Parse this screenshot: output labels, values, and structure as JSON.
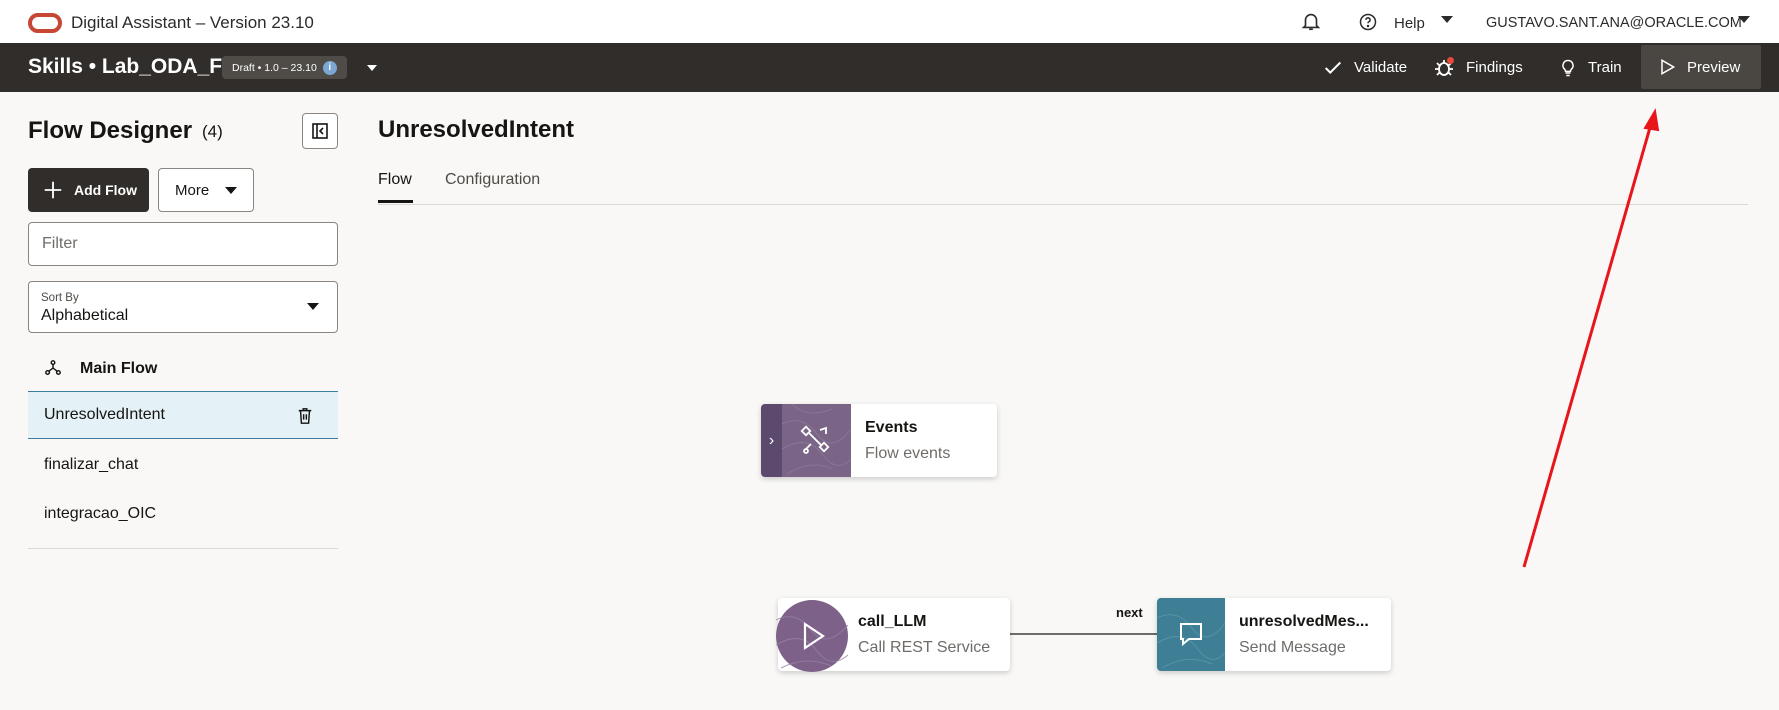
{
  "header": {
    "app_title": "Digital Assistant – Version 23.10",
    "help_label": "Help",
    "user_label": "GUSTAVO.SANT.ANA@ORACLE.COM"
  },
  "toolbar": {
    "skill_title": "Skills • Lab_ODA_FT",
    "version_badge": "Draft • 1.0 – 23.10",
    "info_glyph": "i",
    "validate_label": "Validate",
    "findings_label": "Findings",
    "train_label": "Train",
    "preview_label": "Preview"
  },
  "sidebar": {
    "title": "Flow Designer",
    "count": "(4)",
    "add_flow_label": "Add Flow",
    "more_label": "More",
    "filter_placeholder": "Filter",
    "sort_label": "Sort By",
    "sort_value": "Alphabetical",
    "main_flow_label": "Main Flow",
    "flows": [
      {
        "label": "UnresolvedIntent",
        "selected": true
      },
      {
        "label": "finalizar_chat",
        "selected": false
      },
      {
        "label": "integracao_OIC",
        "selected": false
      }
    ]
  },
  "main": {
    "title": "UnresolvedIntent",
    "tabs": [
      {
        "label": "Flow",
        "active": true
      },
      {
        "label": "Configuration",
        "active": false
      }
    ]
  },
  "canvas": {
    "events_node": {
      "title": "Events",
      "subtitle": "Flow events",
      "expand_glyph": "›"
    },
    "llm_node": {
      "title": "call_LLM",
      "subtitle": "Call REST Service"
    },
    "message_node": {
      "title": "unresolvedMes...",
      "subtitle": "Send Message"
    },
    "transition_label": "next"
  },
  "colors": {
    "dark_toolbar": "#312d2a",
    "oracle_red": "#c74634",
    "annotation_arrow": "#e8151b",
    "selected_row": "#e4f1f7",
    "events_purple": "#7a6587",
    "message_teal": "#3f7f95"
  },
  "icons": [
    "oracle-logo-icon",
    "bell-icon",
    "help-icon",
    "info-icon",
    "checkmark-icon",
    "bug-icon",
    "lightbulb-icon",
    "play-icon",
    "collapse-panel-icon",
    "plus-icon",
    "flow-hierarchy-icon",
    "trash-icon",
    "events-icon",
    "chat-bubble-icon"
  ]
}
